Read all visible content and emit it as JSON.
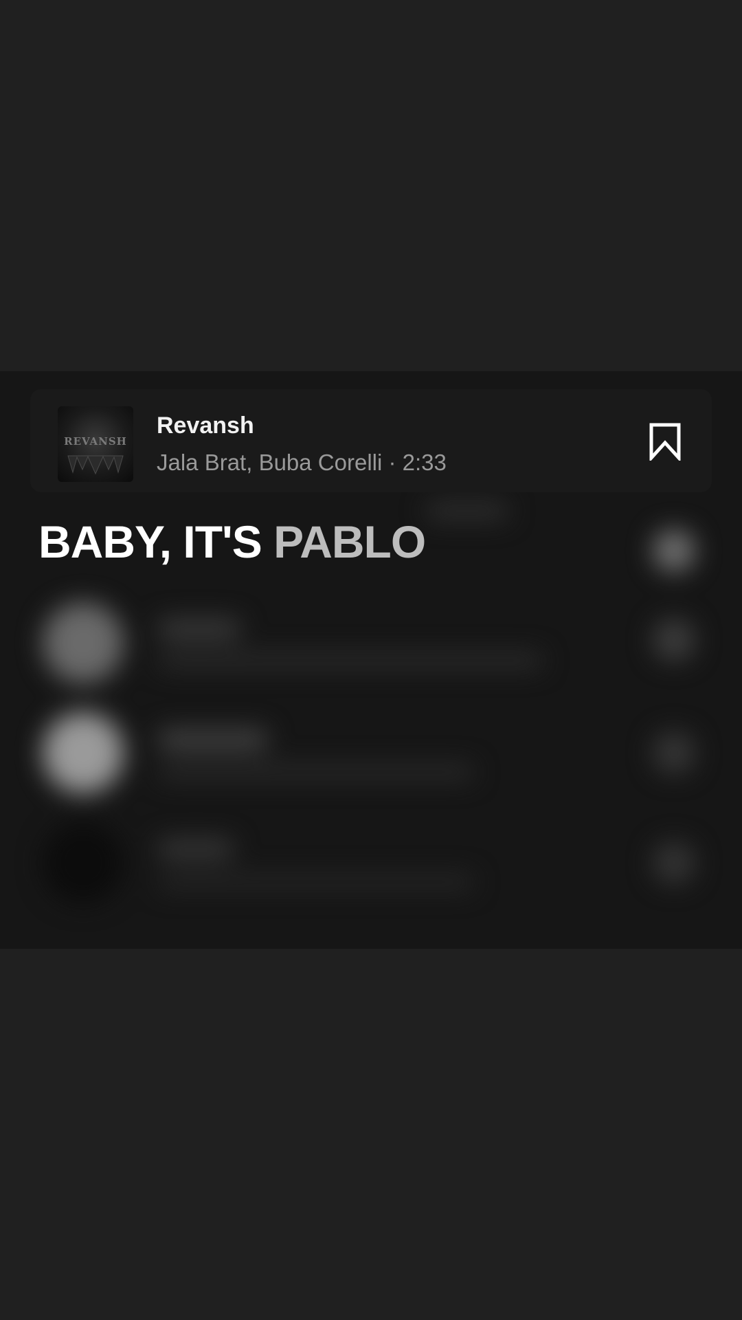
{
  "track": {
    "title": "Revansh",
    "artists": "Jala Brat, Buba Corelli",
    "separator": "·",
    "duration": "2:33",
    "subtitle": "Jala Brat, Buba Corelli · 2:33",
    "cover_text": "REVANSH",
    "bookmark_icon": "bookmark-outline-icon"
  },
  "lyric": {
    "sung": "BABY, IT'S",
    "upcoming": "PABLO"
  },
  "colors": {
    "background": "#202020",
    "card": "#161616",
    "text_primary": "#ffffff",
    "text_secondary": "#9a9a9a",
    "lyric_upcoming": "#bdbdbd"
  }
}
